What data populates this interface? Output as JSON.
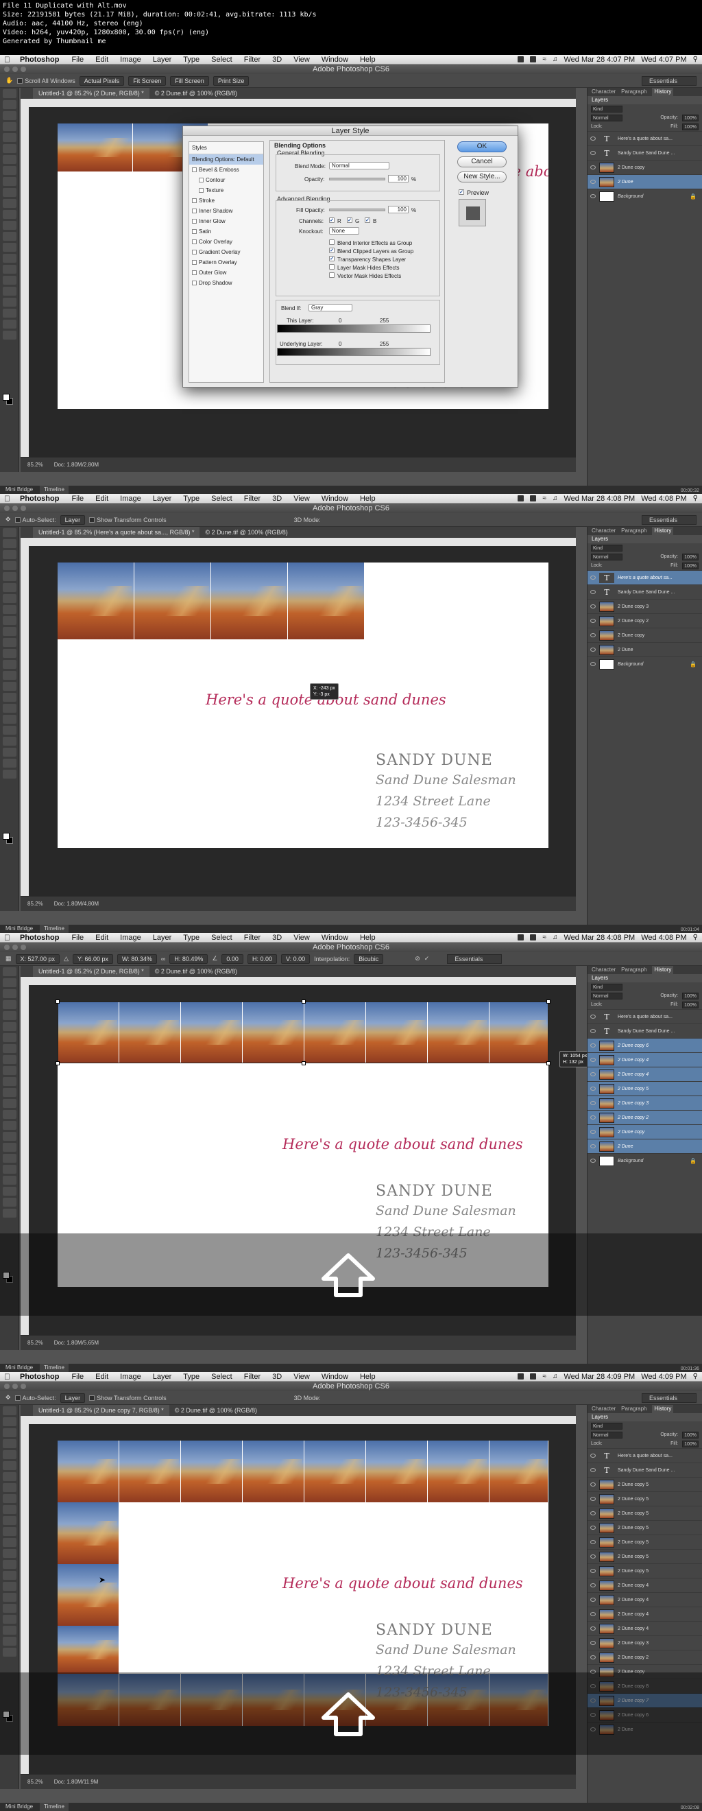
{
  "file_info": [
    "File 11 Duplicate with Alt.mov",
    "Size: 22191581 bytes (21.17 MiB), duration: 00:02:41, avg.bitrate: 1113 kb/s",
    "Audio: aac, 44100 Hz, stereo (eng)",
    "Video: h264, yuv420p, 1280x800, 30.00 fps(r) (eng)",
    "Generated by Thumbnail me"
  ],
  "menu": {
    "app": "Photoshop",
    "items": [
      "File",
      "Edit",
      "Image",
      "Layer",
      "Type",
      "Select",
      "Filter",
      "3D",
      "View",
      "Window",
      "Help"
    ]
  },
  "window_title": "Adobe Photoshop CS6",
  "frames": [
    {
      "clock_menu": "Wed Mar 28  4:07 PM",
      "clock": "Wed 4:07 PM",
      "doc_tab": "Untitled-1 @ 85.2% (2 Dune, RGB/8) *",
      "doc_tab2": "© 2 Dune.tif @ 100% (RGB/8)",
      "zoom": "85.2%",
      "doc_size": "Doc: 1.80M/2.80M",
      "options": {
        "scroll_all": "Scroll All Windows",
        "actual": "Actual Pixels",
        "fit": "Fit Screen",
        "fill": "Fill Screen",
        "print": "Print Size",
        "workspace": "Essentials"
      },
      "timestamp": "00:00:32"
    },
    {
      "clock_menu": "Wed Mar 28  4:08 PM",
      "clock": "Wed 4:08 PM",
      "doc_tab": "Untitled-1 @ 85.2% (Here's a quote about sa..., RGB/8) *",
      "doc_tab2": "© 2 Dune.tif @ 100% (RGB/8)",
      "zoom": "85.2%",
      "doc_size": "Doc: 1.80M/4.80M",
      "options": {
        "auto_select": "Auto-Select:",
        "layer": "Layer",
        "show_transform": "Show Transform Controls",
        "mode_3d": "3D Mode:",
        "workspace": "Essentials"
      },
      "tooltip": [
        "X: -243 px",
        "Y:   -3 px"
      ],
      "timestamp": "00:01:04"
    },
    {
      "clock_menu": "Wed Mar 28  4:08 PM",
      "clock": "Wed 4:08 PM",
      "doc_tab": "Untitled-1 @ 85.2% (2 Dune, RGB/8) *",
      "doc_tab2": "© 2 Dune.tif @ 100% (RGB/8)",
      "zoom": "85.2%",
      "doc_size": "Doc: 1.80M/5.65M",
      "options": {
        "x": "X: 527.00 px",
        "y": "Y: 66.00 px",
        "w": "W: 80.34%",
        "h": "H: 80.49%",
        "angle": "0.00",
        "hskew": "H: 0.00",
        "vskew": "V: 0.00",
        "interp": "Interpolation:",
        "interp_val": "Bicubic",
        "workspace": "Essentials"
      },
      "tooltip": [
        "W: 1054 px",
        "H:  132 px"
      ],
      "timestamp": "00:01:36"
    },
    {
      "clock_menu": "Wed Mar 28  4:09 PM",
      "clock": "Wed 4:09 PM",
      "doc_tab": "Untitled-1 @ 85.2% (2 Dune copy 7, RGB/8) *",
      "doc_tab2": "© 2 Dune.tif @ 100% (RGB/8)",
      "zoom": "85.2%",
      "doc_size": "Doc: 1.80M/11.9M",
      "options": {
        "auto_select": "Auto-Select:",
        "layer": "Layer",
        "show_transform": "Show Transform Controls",
        "mode_3d": "3D Mode:",
        "workspace": "Essentials"
      },
      "timestamp": "00:02:08"
    }
  ],
  "document": {
    "quote": "Here's a quote about sand dunes",
    "name": "SANDY DUNE",
    "title": "Sand Dune Salesman",
    "address": "1234 Street Lane",
    "phone": "123-3456-345"
  },
  "panel": {
    "tabs": [
      "Character",
      "Paragraph",
      "History"
    ],
    "layers_tab": "Layers",
    "kind": "Kind",
    "blend": "Normal",
    "opacity_label": "Opacity:",
    "opacity": "100%",
    "lock_label": "Lock:",
    "fill_label": "Fill:",
    "fill": "100%"
  },
  "layers_frame1": [
    "Here's a quote about sa...",
    "Sandy Dune Sand Dune ...",
    "2 Dune copy",
    "2 Dune",
    "Background"
  ],
  "layers_frame2": [
    "Here's a quote about sa...",
    "Sandy Dune Sand Dune ...",
    "2 Dune copy 3",
    "2 Dune copy 2",
    "2 Dune copy",
    "2 Dune",
    "Background"
  ],
  "layers_frame3": [
    "Here's a quote about sa...",
    "Sandy Dune Sand Dune ...",
    "2 Dune copy 6",
    "2 Dune copy 4",
    "2 Dune copy 4",
    "2 Dune copy 5",
    "2 Dune copy 3",
    "2 Dune copy 2",
    "2 Dune copy",
    "2 Dune",
    "Background"
  ],
  "layers_frame4": [
    "Here's a quote about sa...",
    "Sandy Dune Sand Dune ...",
    "2 Dune copy 5",
    "2 Dune copy 5",
    "2 Dune copy 5",
    "2 Dune copy 5",
    "2 Dune copy 5",
    "2 Dune copy 5",
    "2 Dune copy 5",
    "2 Dune copy 4",
    "2 Dune copy 4",
    "2 Dune copy 4",
    "2 Dune copy 4",
    "2 Dune copy 3",
    "2 Dune copy 2",
    "2 Dune copy",
    "2 Dune copy 8",
    "2 Dune copy 7",
    "2 Dune copy 6",
    "2 Dune"
  ],
  "dialog": {
    "title": "Layer Style",
    "styles_header": "Styles",
    "styles": [
      "Blending Options: Default",
      "Bevel & Emboss",
      "Contour",
      "Texture",
      "Stroke",
      "Inner Shadow",
      "Inner Glow",
      "Satin",
      "Color Overlay",
      "Gradient Overlay",
      "Pattern Overlay",
      "Outer Glow",
      "Drop Shadow"
    ],
    "blending_options": "Blending Options",
    "general": "General Blending",
    "blend_mode_label": "Blend Mode:",
    "blend_mode": "Normal",
    "opacity_label": "Opacity:",
    "opacity": "100",
    "advanced": "Advanced Blending",
    "fill_opacity_label": "Fill Opacity:",
    "fill_opacity": "100",
    "channels_label": "Channels:",
    "channels": [
      "R",
      "G",
      "B"
    ],
    "knockout_label": "Knockout:",
    "knockout": "None",
    "checks": [
      "Blend Interior Effects as Group",
      "Blend Clipped Layers as Group",
      "Transparency Shapes Layer",
      "Layer Mask Hides Effects",
      "Vector Mask Hides Effects"
    ],
    "blend_if_label": "Blend If:",
    "blend_if": "Gray",
    "this_layer": "This Layer:",
    "underlying": "Underlying Layer:",
    "zero": "0",
    "max": "255",
    "ok": "OK",
    "cancel": "Cancel",
    "new_style": "New Style...",
    "preview": "Preview",
    "percent": "%"
  },
  "bridge": {
    "mini": "Mini Bridge",
    "timeline": "Timeline"
  }
}
